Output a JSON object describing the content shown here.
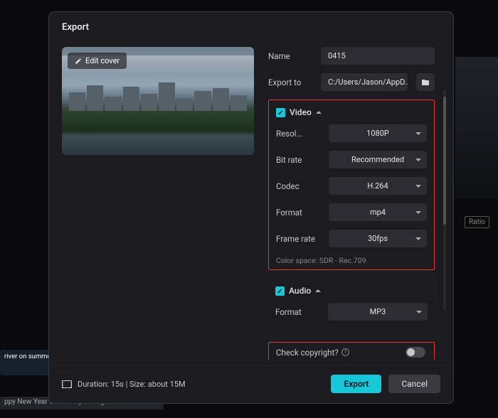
{
  "backdrop": {
    "strip1_text": "river on summer",
    "strip2_text": "ppy New Year Voice & Sparkling Sound",
    "ratio_label": "Ratio"
  },
  "dialog": {
    "title": "Export"
  },
  "preview": {
    "edit_cover_label": "Edit cover"
  },
  "form": {
    "name_label": "Name",
    "name_value": "0415",
    "export_to_label": "Export to",
    "export_to_value": "C:/Users/Jason/AppD..."
  },
  "video": {
    "section_label": "Video",
    "resolution_label": "Resol...",
    "resolution_value": "1080P",
    "bitrate_label": "Bit rate",
    "bitrate_value": "Recommended",
    "codec_label": "Codec",
    "codec_value": "H.264",
    "format_label": "Format",
    "format_value": "mp4",
    "framerate_label": "Frame rate",
    "framerate_value": "30fps",
    "colorspace_note": "Color space: SDR - Rec.709"
  },
  "audio": {
    "section_label": "Audio",
    "format_label": "Format",
    "format_value": "MP3"
  },
  "copyright": {
    "label": "Check copyright?"
  },
  "footer": {
    "info": "Duration: 15s | Size: about 15M",
    "export_label": "Export",
    "cancel_label": "Cancel"
  }
}
